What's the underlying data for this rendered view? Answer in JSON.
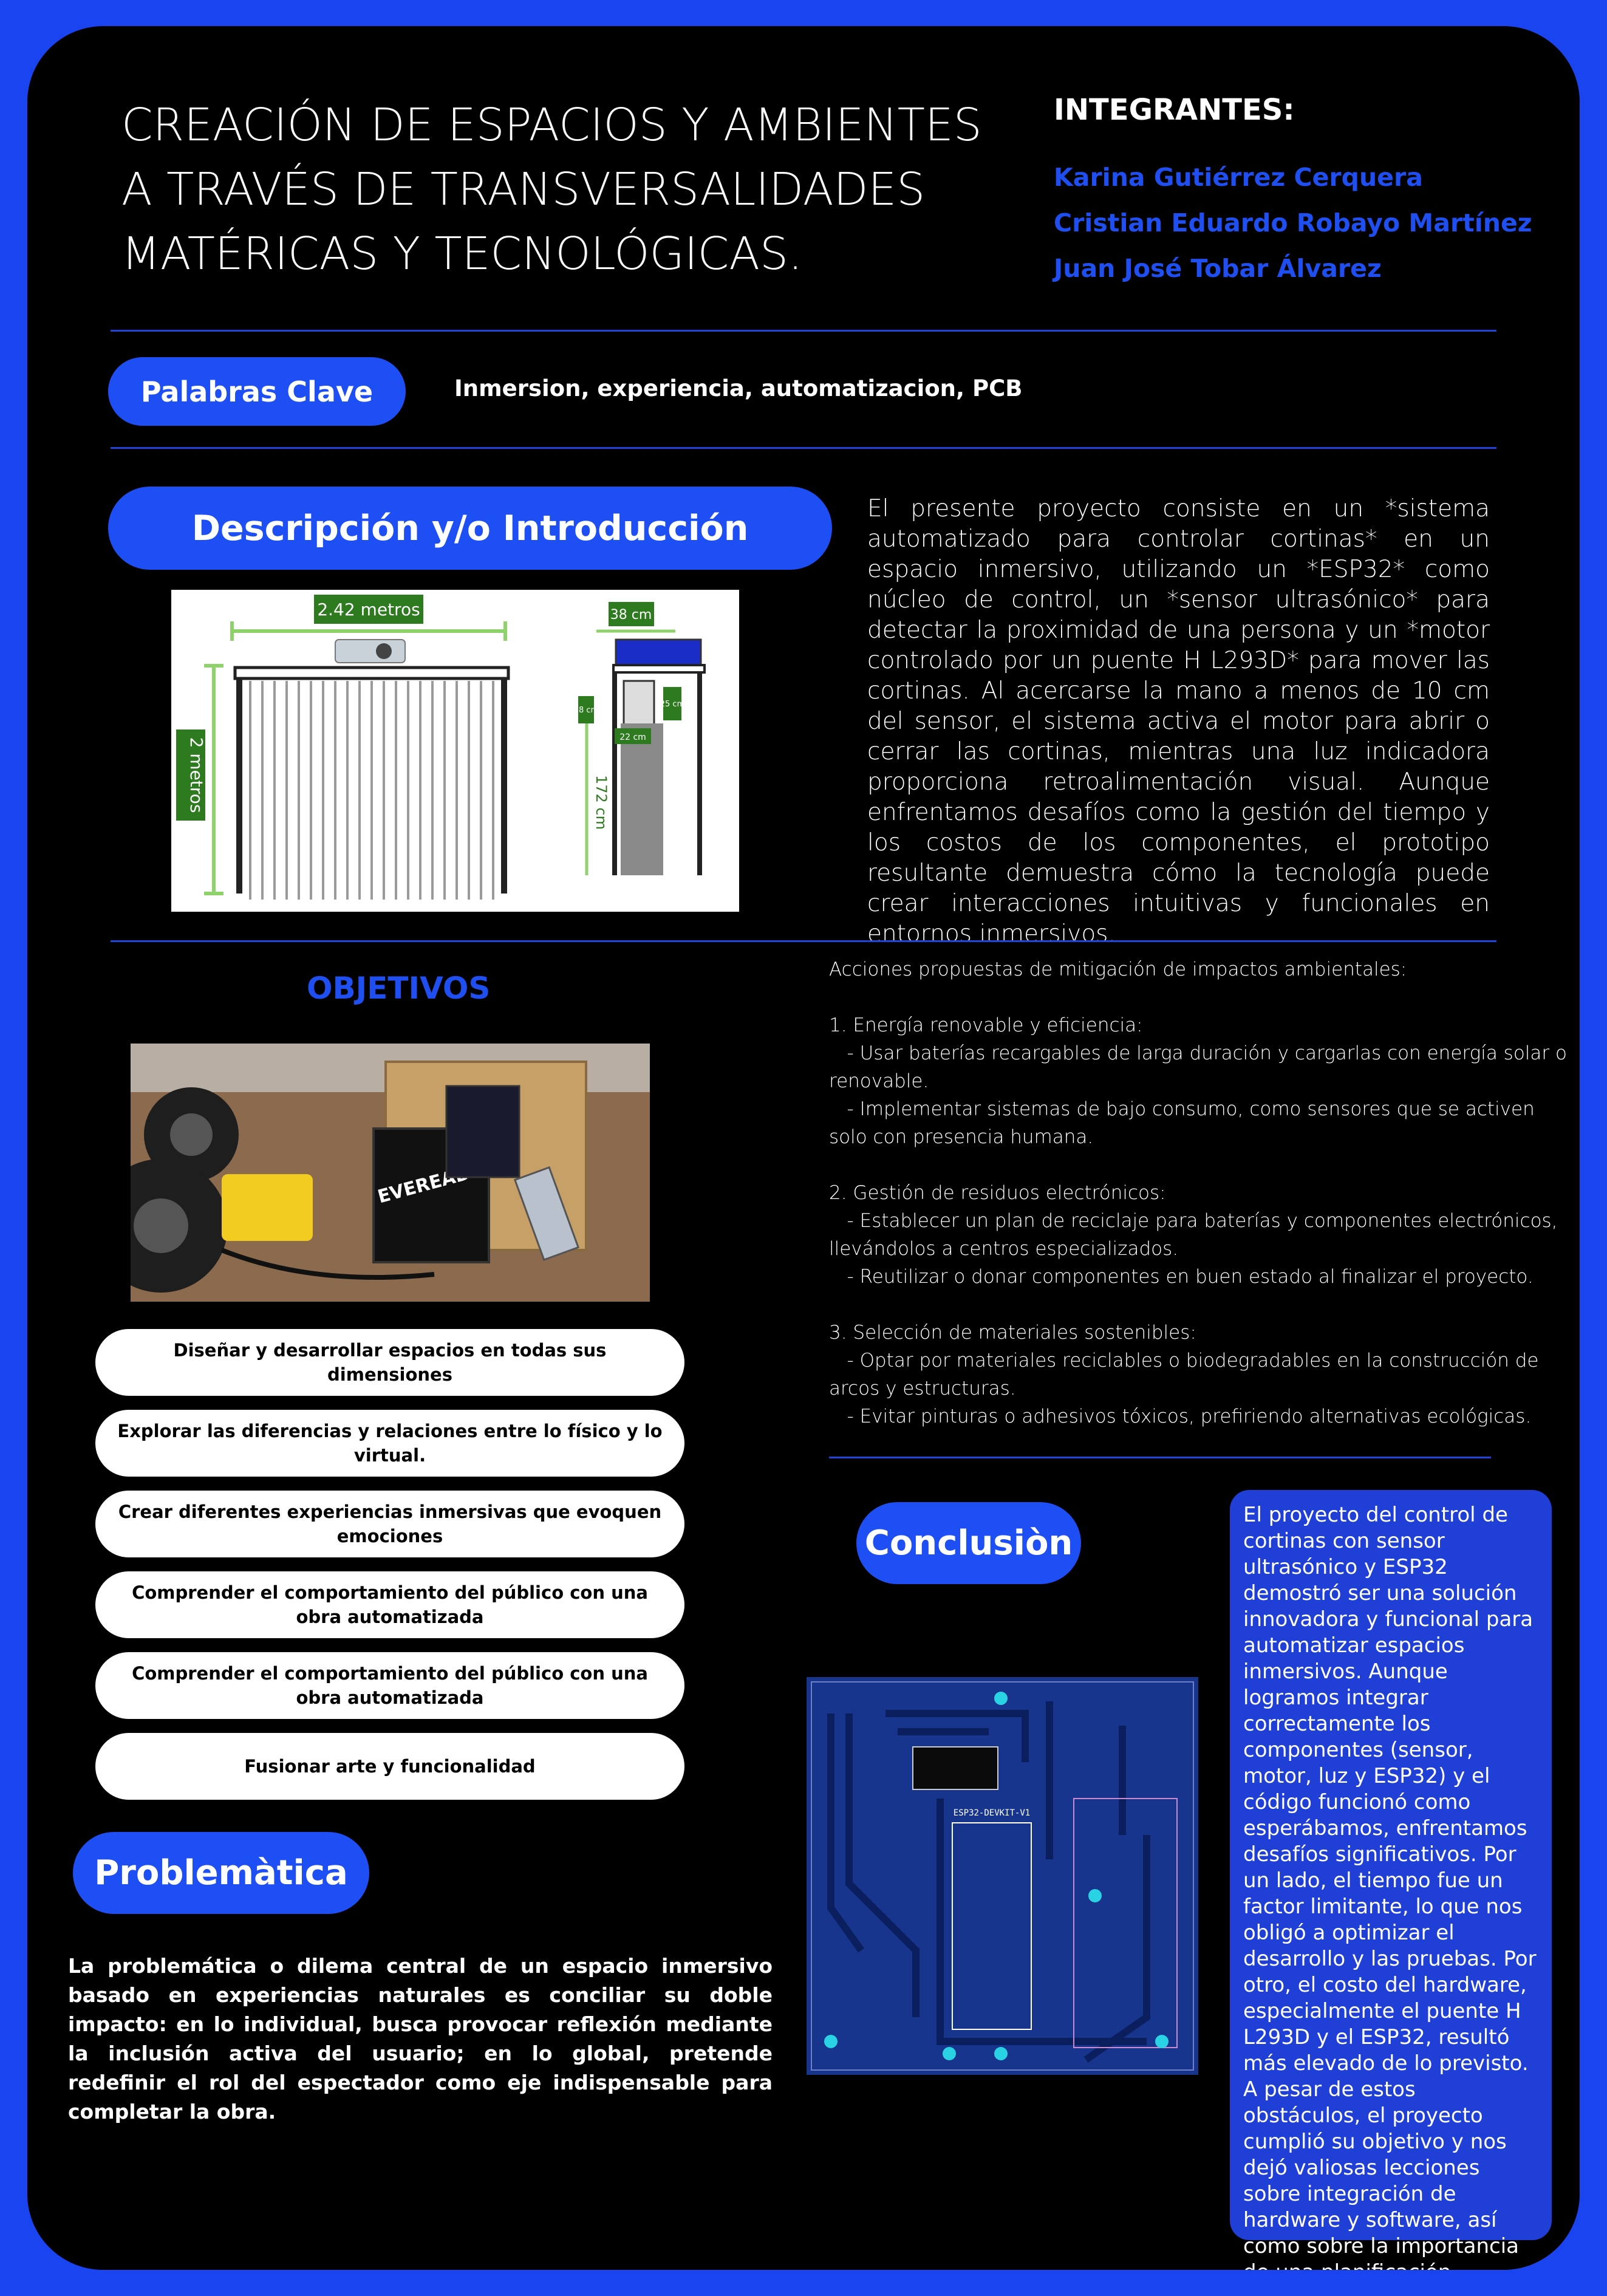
{
  "header": {
    "title_lines": [
      "CREACIÓN DE ESPACIOS Y AMBIENTES",
      "A TRAVÉS DE TRANSVERSALIDADES",
      "MATÉRICAS Y TECNOLÓGICAS."
    ],
    "integrantes_heading": "INTEGRANTES:",
    "members": [
      "Karina Gutiérrez Cerquera",
      "Cristian Eduardo Robayo Martínez",
      "Juan José Tobar Álvarez"
    ]
  },
  "keywords": {
    "label": "Palabras Clave",
    "text": "Inmersion, experiencia, automatizacion, PCB"
  },
  "intro": {
    "heading": "Descripción y/o Introducción",
    "text": "El presente proyecto consiste en un *sistema automatizado para controlar cortinas* en un espacio inmersivo, utilizando un *ESP32* como núcleo de control, un *sensor ultrasónico* para detectar la proximidad de una persona y un *motor controlado por un puente H L293D* para mover las cortinas. Al acercarse la mano a menos de 10 cm del sensor, el sistema activa el motor para abrir o cerrar las cortinas, mientras una luz indicadora proporciona retroalimentación visual. Aunque enfrentamos desafíos como la gestión del tiempo y los costos de los componentes, el prototipo resultante demuestra cómo la tecnología puede crear interacciones intuitivas y funcionales en entornos inmersivos.",
    "diagram": {
      "width_label": "2.42 metros",
      "height_label": "2 metros",
      "side_width_label": "38 cm",
      "side_height_label": "172 cm",
      "small_label_1": "18 cm",
      "small_label_2": "25 cm",
      "small_label_3": "22 cm"
    }
  },
  "objectives": {
    "heading": "OBJETIVOS",
    "items": [
      "Diseñar y desarrollar espacios en todas sus dimensiones",
      "Explorar las diferencias y relaciones entre lo físico y lo virtual.",
      "Crear diferentes experiencias inmersivas que evoquen emociones",
      "Comprender el comportamiento del público con una obra automatizada",
      "Comprender el comportamiento del público con una obra automatizada",
      "Fusionar arte y funcionalidad"
    ],
    "photo_battery_text": "EVEREADY"
  },
  "actions": {
    "text": "Acciones propuestas de mitigación de impactos ambientales:\n\n1. Energía renovable y eficiencia:\n   - Usar baterías recargables de larga duración y cargarlas con energía solar o renovable.\n   - Implementar sistemas de bajo consumo, como sensores que se activen solo con presencia humana.\n\n2. Gestión de residuos electrónicos:\n   - Establecer un plan de reciclaje para baterías y componentes electrónicos, llevándolos a centros especializados.\n   - Reutilizar o donar componentes en buen estado al finalizar el proyecto.\n\n3. Selección de materiales sostenibles:\n   - Optar por materiales reciclables o biodegradables en la construcción de arcos y estructuras.\n   - Evitar pinturas o adhesivos tóxicos, prefiriendo alternativas ecológicas."
  },
  "conclusion": {
    "heading": "Conclusiòn",
    "text": "El proyecto del control de cortinas con sensor ultrasónico y ESP32 demostró ser una solución innovadora y funcional para automatizar espacios inmersivos. Aunque logramos integrar correctamente los componentes (sensor, motor, luz y ESP32) y el código funcionó como esperábamos, enfrentamos desafíos significativos. Por un lado, el tiempo fue un factor limitante, lo que nos obligó a optimizar el desarrollo y las pruebas. Por otro, el costo del hardware, especialmente el puente H L293D y el ESP32, resultó más elevado de lo previsto. A pesar de estos obstáculos, el proyecto cumplió su objetivo y nos dejó valiosas lecciones sobre integración de hardware y software, así como sobre la importancia de una planificación eficiente.",
    "pcb_label": "ESP32-DEVKIT-V1"
  },
  "problem": {
    "heading": "Problemàtica",
    "text": "La problemática o dilema central de un espacio inmersivo basado en experiencias naturales es conciliar su doble impacto: en lo individual, busca provocar reflexión mediante la inclusión activa del usuario; en lo global, pretende redefinir el rol del espectador como eje indispensable para completar la obra."
  },
  "colors": {
    "accent": "#1f4ff0",
    "frame": "#1a44f0",
    "background": "#000000",
    "pcb": "#17358c"
  }
}
